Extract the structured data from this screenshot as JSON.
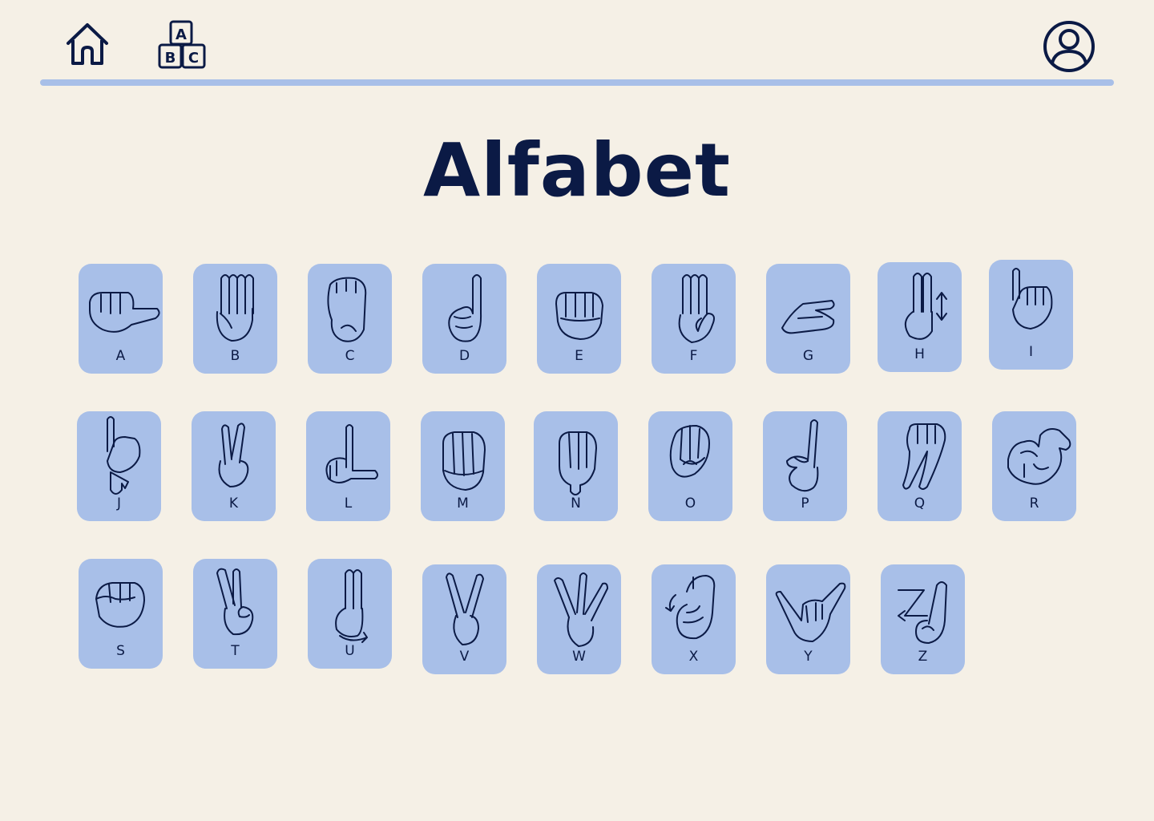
{
  "header": {
    "home_icon": "home-icon",
    "alphabet_icon": "abc-blocks-icon",
    "alphabet_blocks": [
      "A",
      "B",
      "C"
    ],
    "profile_icon": "user-profile-icon",
    "accent_color": "#a8bfe8",
    "ink_color": "#0b1a45",
    "background_color": "#f5f0e6"
  },
  "title": "Alfabet",
  "letters": [
    "A",
    "B",
    "C",
    "D",
    "E",
    "F",
    "G",
    "H",
    "I",
    "J",
    "K",
    "L",
    "M",
    "N",
    "O",
    "P",
    "Q",
    "R",
    "S",
    "T",
    "U",
    "V",
    "W",
    "X",
    "Y",
    "Z"
  ]
}
